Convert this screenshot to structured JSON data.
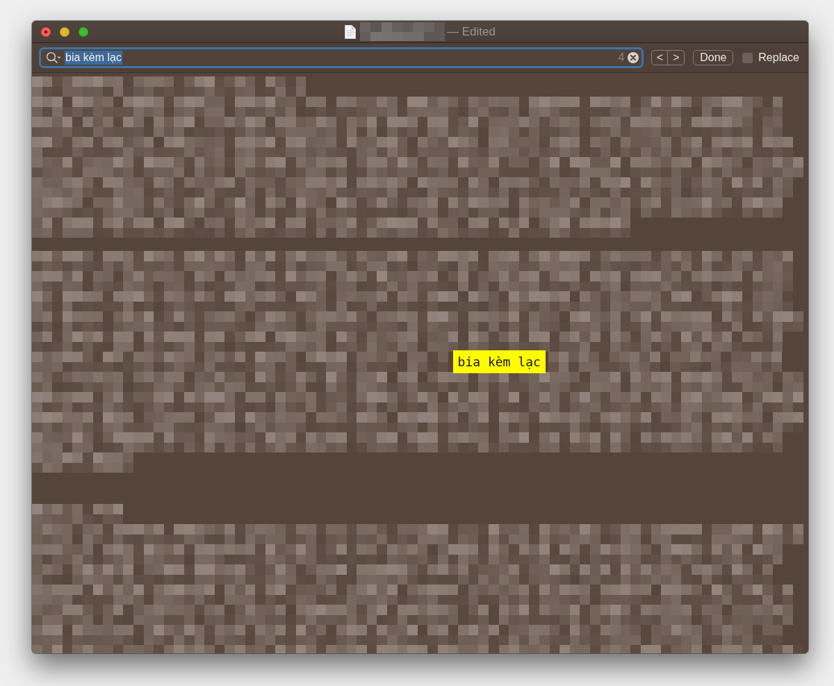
{
  "window": {
    "edited": true,
    "title_suffix": "— Edited"
  },
  "find_bar": {
    "search": {
      "value": "bia kèm lạc",
      "text_selected": true,
      "match_count": "4"
    },
    "previous_label": "<",
    "next_label": ">",
    "done_label": "Done",
    "replace": {
      "label": "Replace",
      "checked": false
    }
  },
  "document": {
    "highlighted_match": "bia kèm lạc"
  }
}
